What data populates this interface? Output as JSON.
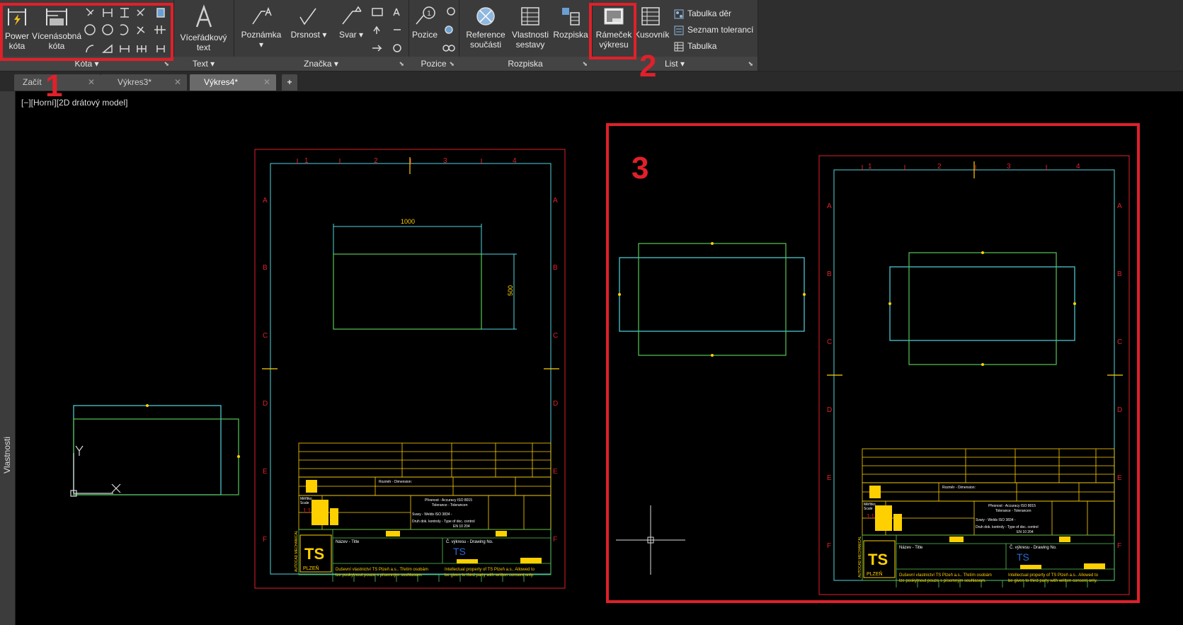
{
  "ribbon": {
    "kota": {
      "power_label1": "Power",
      "power_label2": "kóta",
      "multi_label1": "Vícenásobná",
      "multi_label2": "kóta",
      "panel": "Kóta"
    },
    "text": {
      "btn_label1": "Víceřádkový",
      "btn_label2": "text",
      "panel": "Text"
    },
    "znacka": {
      "poznamka": "Poznámka",
      "drsnost": "Drsnost",
      "svar": "Svar",
      "panel": "Značka"
    },
    "pozice": {
      "btn": "Pozice",
      "panel": "Pozice"
    },
    "rozpiska": {
      "ref_label1": "Reference",
      "ref_label2": "součásti",
      "vlast_label1": "Vlastnosti",
      "vlast_label2": "sestavy",
      "rozpiska": "Rozpiska",
      "panel": "Rozpiska"
    },
    "list": {
      "ramecek_label1": "Rámeček",
      "ramecek_label2": "výkresu",
      "kusovnik": "Kusovník",
      "tabulka_der": "Tabulka děr",
      "seznam": "Seznam tolerancí",
      "tabulka": "Tabulka",
      "panel": "List"
    }
  },
  "tabs": [
    {
      "label": "Začít"
    },
    {
      "label": "Výkres3*"
    },
    {
      "label": "Výkres4*"
    }
  ],
  "sidebar": {
    "label": "Vlastnosti"
  },
  "viewport": {
    "label": "[−][Horní][2D drátový model]"
  },
  "drawing": {
    "dim_width": "1000",
    "dim_height": "500",
    "cols": [
      "1",
      "2",
      "3",
      "4"
    ],
    "rows": [
      "A",
      "B",
      "C",
      "D",
      "E",
      "F"
    ],
    "tb_line1": "Duševní vlastnictví TS Plzeň a.s.. Třetím osobám",
    "tb_line2": "lze poskytnout pouze s písemným souhlasem.",
    "tb_line3": "Intellectual property of TS Plzeň a.s.. Allowed to",
    "tb_line4": "be given to third party with written consent only.",
    "tb_title": "Název - Title",
    "tb_drawno": "Č. výkresu - Drawing No.",
    "tb_logo": "TS",
    "tb_plzen": "PLZEŇ",
    "tb_rozmer": "Rozměr - Dimension:",
    "tb_presnost": "Přesnost - Accuracy ISO 8015",
    "tb_tolerance": "Tolerance - Tolerancen",
    "tb_svary": "Svary - Welds ISO 3834 -",
    "tb_druh": "Druh dok. kontroly - Type of doc. control",
    "tb_en": "EN 10 204",
    "tb_meritko": "Měřítko",
    "tb_scale": "Scale",
    "tb_11": "1:1",
    "tb_logo_side": "AUTOCAD MECHANICAL"
  },
  "annotations": {
    "n1": "1",
    "n2": "2",
    "n3": "3"
  },
  "colors": {
    "red": "#e0202a",
    "cyan": "#4fd6e0",
    "green": "#55c855",
    "yellow": "#ffd000",
    "frame_red": "#e0202a"
  }
}
